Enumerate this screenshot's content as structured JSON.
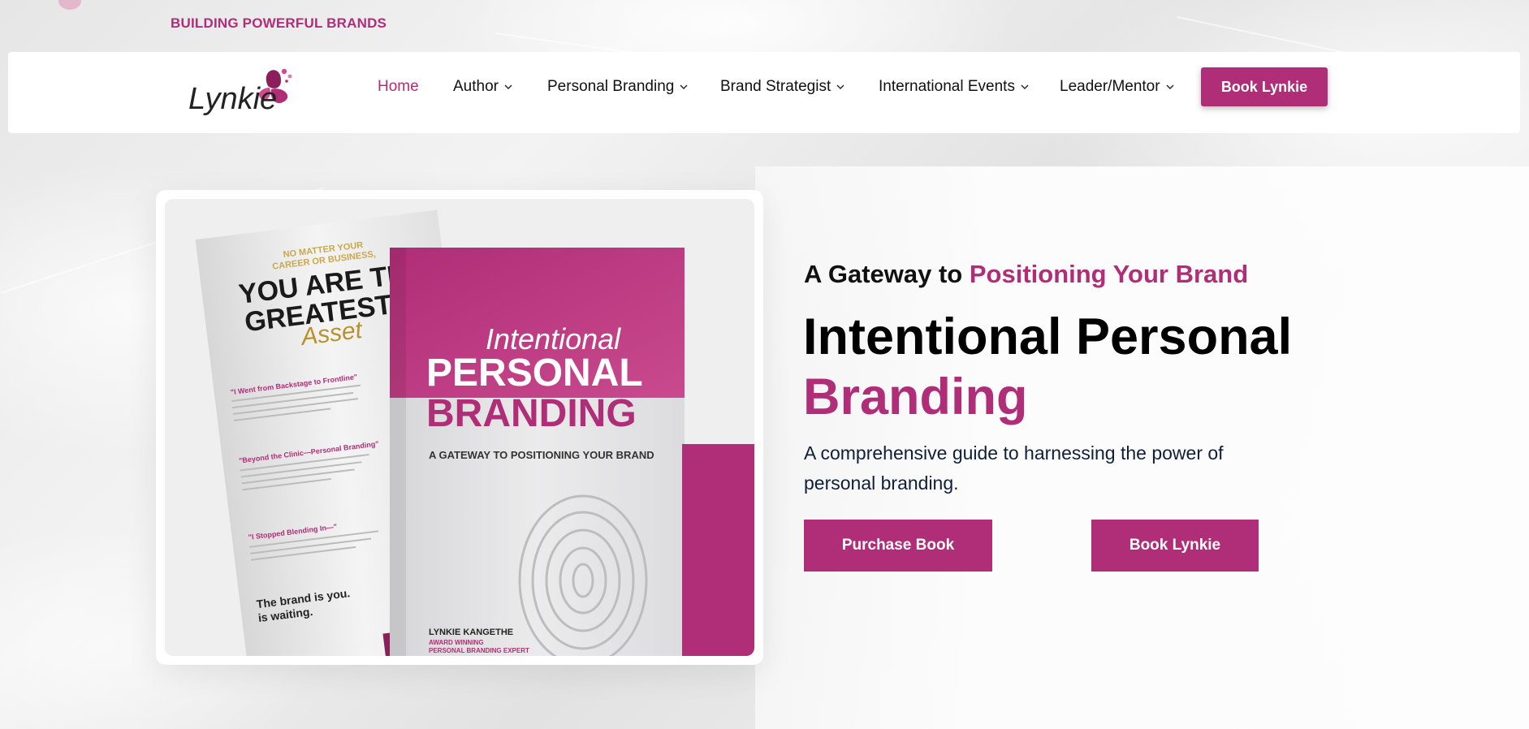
{
  "topbar": {
    "tagline": "BUILDING POWERFUL BRANDS"
  },
  "logo": {
    "text": "Lynkie",
    "icon": "butterfly-icon"
  },
  "nav": {
    "items": [
      {
        "label": "Home",
        "active": true,
        "has_dropdown": false
      },
      {
        "label": "Author",
        "active": false,
        "has_dropdown": true
      },
      {
        "label": "Personal Branding",
        "active": false,
        "has_dropdown": true
      },
      {
        "label": "Brand Strategist",
        "active": false,
        "has_dropdown": true
      },
      {
        "label": "International Events",
        "active": false,
        "has_dropdown": true
      },
      {
        "label": "Leader/Mentor",
        "active": false,
        "has_dropdown": true
      }
    ],
    "cta_label": "Book Lynkie"
  },
  "hero": {
    "subtitle_prefix": "A Gateway to ",
    "subtitle_accent": "Positioning Your Brand",
    "title_line1": "Intentional Personal",
    "title_line2": "Branding",
    "description": "A comprehensive guide to harnessing the power of personal branding.",
    "primary_button": "Purchase Book",
    "secondary_button": "Book Lynkie"
  },
  "book_image": {
    "back_cover": {
      "kicker_line1": "NO MATTER YOUR",
      "kicker_line2": "CAREER OR BUSINESS,",
      "headline_line1": "YOU ARE THE",
      "headline_line2": "GREATEST",
      "headline_script": "Asset",
      "section1": "\"I Went from Backstage to Frontline\"",
      "section2": "\"Beyond the Clinic—Personal Branding\"",
      "section3": "\"I Stopped Blending In—\"",
      "closing_line1": "The brand is you.",
      "closing_line2": "is waiting."
    },
    "front_cover": {
      "script_title": "Intentional",
      "title_line1": "PERSONAL",
      "title_line2": "BRANDING",
      "subtitle": "A GATEWAY TO POSITIONING YOUR BRAND",
      "author": "LYNKIE KANGETHE",
      "author_tag1": "AWARD WINNING",
      "author_tag2": "PERSONAL BRANDING EXPERT"
    }
  },
  "colors": {
    "brand": "#b02d77",
    "brand_dark": "#8a1f5c",
    "text_dark": "#0f1f3a"
  }
}
